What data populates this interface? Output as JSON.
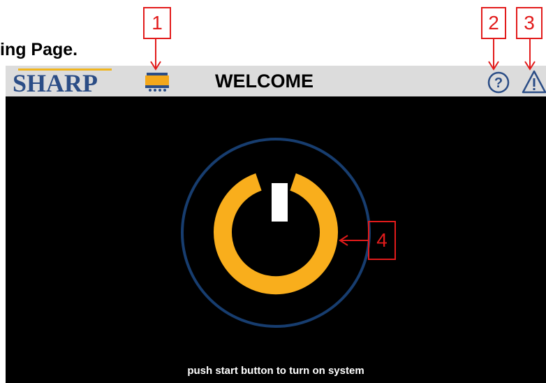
{
  "page_heading": "ing Page.",
  "topbar": {
    "logo_text": "SHARP",
    "title": "WELCOME",
    "icons": [
      "printer-icon",
      "help-icon",
      "warning-icon"
    ]
  },
  "screen": {
    "instruction": "push start button to turn on system"
  },
  "callouts": {
    "c1": "1",
    "c2": "2",
    "c3": "3",
    "c4": "4"
  },
  "colors": {
    "accent": "#f9ae1c",
    "ring": "#173d6f",
    "callout_red": "#e21b1b",
    "brand_blue": "#2b4d86",
    "bar_gray": "#dcdcdc"
  }
}
